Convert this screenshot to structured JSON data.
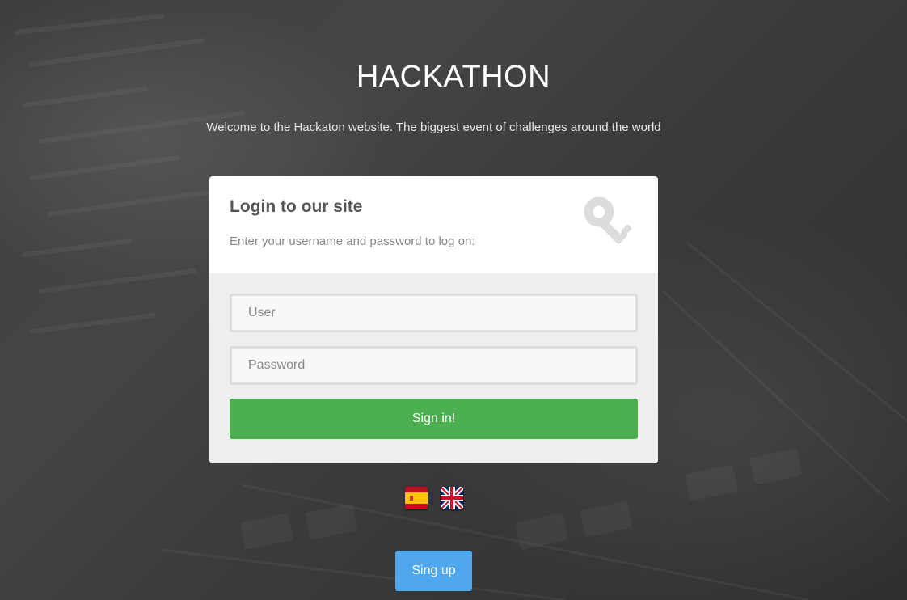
{
  "header": {
    "title": "HACKATHON",
    "subtitle": "Welcome to the Hackaton website. The biggest event of challenges around the world"
  },
  "login": {
    "heading": "Login to our site",
    "description": "Enter your username and password to log on:",
    "icon": "key-icon",
    "user_placeholder": "User",
    "password_placeholder": "Password",
    "signin_label": "Sign in!"
  },
  "languages": [
    {
      "icon": "spain-flag-icon",
      "code": "es"
    },
    {
      "icon": "uk-flag-icon",
      "code": "en"
    }
  ],
  "signup": {
    "label": "Sing up"
  },
  "colors": {
    "signin": "#4caf50",
    "signup": "#4fa8ee",
    "card_top": "#ffffff",
    "card_bottom": "#eeeeee"
  }
}
